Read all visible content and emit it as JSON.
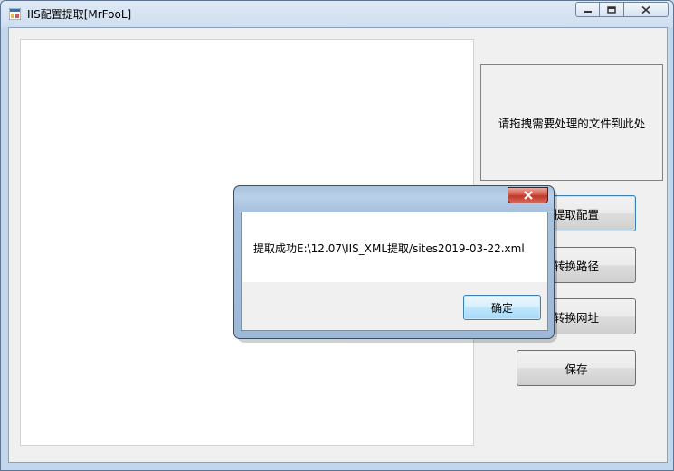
{
  "window": {
    "title": "IIS配置提取[MrFooL]",
    "controls": {
      "minimize": "minimize-icon",
      "maximize": "maximize-icon",
      "close": "close-icon"
    }
  },
  "main": {
    "output_text": "",
    "drop_zone_label": "请拖拽需要处理的文件到此处",
    "buttons": [
      {
        "label": "提取配置"
      },
      {
        "label": "转换路径"
      },
      {
        "label": "转换网址"
      },
      {
        "label": "保存"
      }
    ]
  },
  "dialog": {
    "message": "提取成功E:\\12.07\\IIS_XML提取/sites2019-03-22.xml",
    "ok_label": "确定",
    "close_icon": "close-icon"
  },
  "colors": {
    "titlebar": "#dfe9f5",
    "client_bg": "#f0f0f0",
    "dialog_close": "#c2372a",
    "focus_border": "#3c7fb1"
  }
}
